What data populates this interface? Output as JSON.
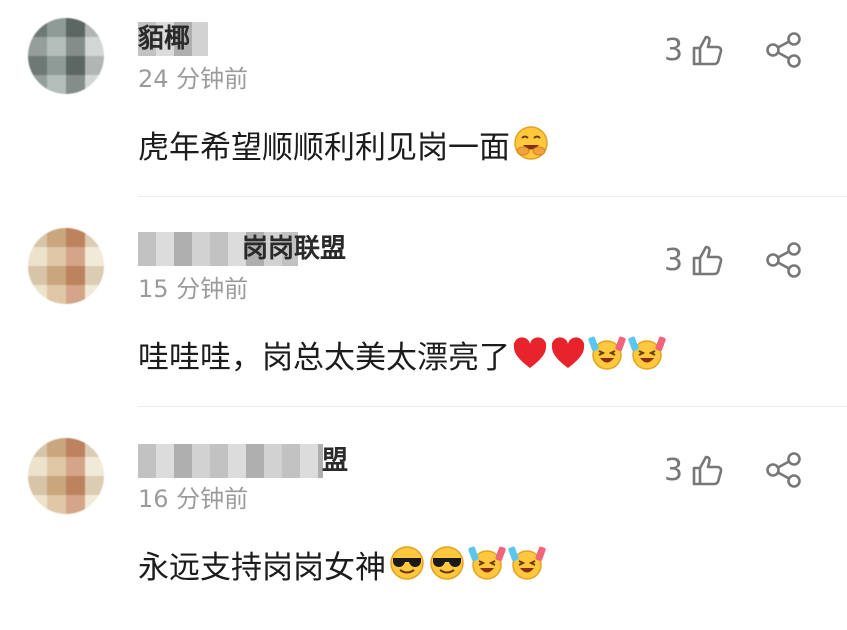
{
  "comments": [
    {
      "username": "貊椰",
      "time": "24 分钟前",
      "text": "虎年希望顺顺利利见岗一面",
      "emojis": [
        "hugging-face-emoji"
      ],
      "likes": "3"
    },
    {
      "username": "岗岗联盟",
      "time": "15 分钟前",
      "text": "哇哇哇，岗总太美太漂亮了",
      "emojis": [
        "red-heart-emoji",
        "red-heart-emoji",
        "cheering-face-emoji",
        "cheering-face-emoji"
      ],
      "likes": "3"
    },
    {
      "username": "盟",
      "time": "16 分钟前",
      "text": "永远支持岗岗女神",
      "emojis": [
        "sunglasses-face-emoji",
        "sunglasses-face-emoji",
        "cheering-face-emoji",
        "cheering-face-emoji"
      ],
      "likes": "3"
    }
  ],
  "colors": {
    "text": "#1c1c1c",
    "meta": "#9b9b9b",
    "icon": "#777777",
    "heart": "#e8232b",
    "emoji_yellow": "#ffc83d"
  }
}
